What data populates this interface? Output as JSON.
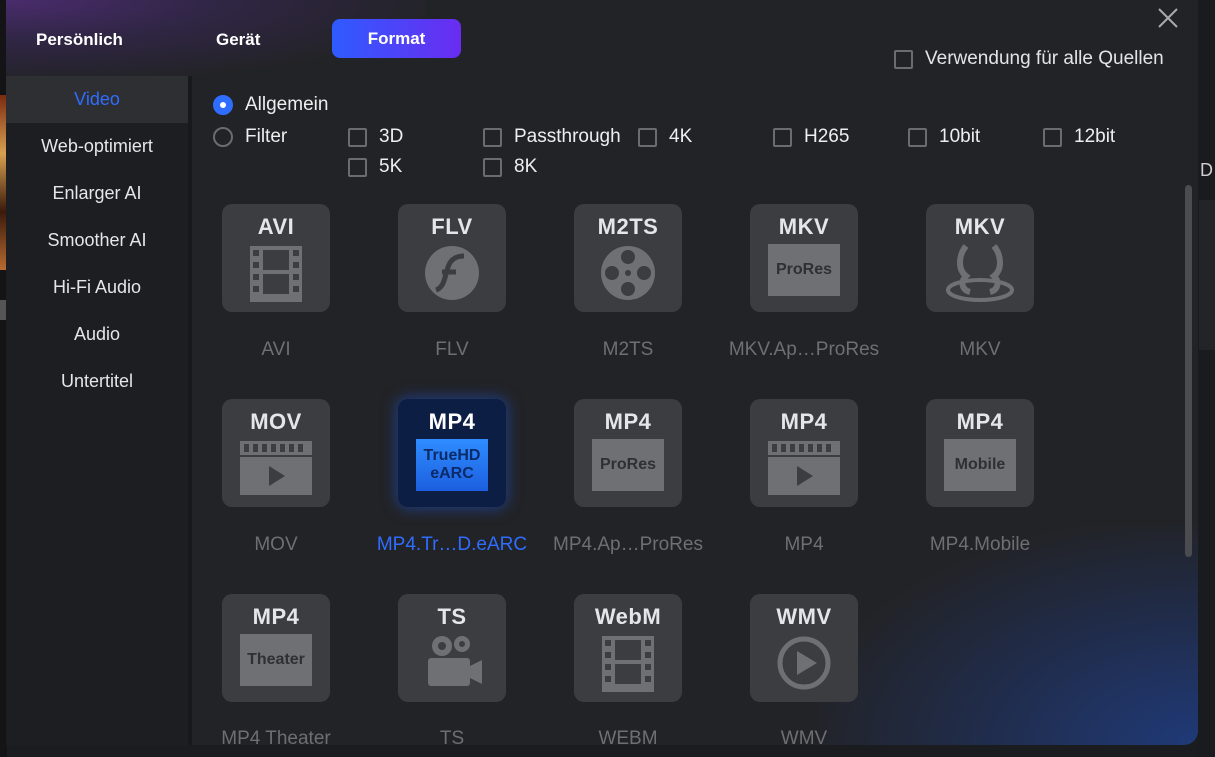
{
  "dialog": {
    "tabs": [
      {
        "label": "Persönlich"
      },
      {
        "label": "Gerät"
      },
      {
        "label": "Format",
        "active": true
      }
    ],
    "all_sources_label": "Verwendung für alle Quellen",
    "all_sources_checked": false,
    "background_right_letter": "D"
  },
  "sidebar": {
    "items": [
      {
        "label": "Video",
        "active": true
      },
      {
        "label": "Web-optimiert"
      },
      {
        "label": "Enlarger AI"
      },
      {
        "label": "Smoother AI"
      },
      {
        "label": "Hi-Fi Audio"
      },
      {
        "label": "Audio"
      },
      {
        "label": "Untertitel"
      }
    ]
  },
  "filters": {
    "radio_general": {
      "label": "Allgemein",
      "selected": true
    },
    "radio_filter": {
      "label": "Filter",
      "selected": false
    },
    "checks": [
      {
        "label": "3D",
        "checked": false
      },
      {
        "label": "Passthrough",
        "checked": false
      },
      {
        "label": "4K",
        "checked": false
      },
      {
        "label": "H265",
        "checked": false
      },
      {
        "label": "10bit",
        "checked": false
      },
      {
        "label": "12bit",
        "checked": false
      },
      {
        "label": "5K",
        "checked": false
      },
      {
        "label": "8K",
        "checked": false
      }
    ]
  },
  "formats": [
    {
      "title": "AVI",
      "label": "AVI",
      "icon": "film-strip-icon"
    },
    {
      "title": "FLV",
      "label": "FLV",
      "icon": "flash-icon"
    },
    {
      "title": "M2TS",
      "label": "M2TS",
      "icon": "film-reel-icon"
    },
    {
      "title": "MKV",
      "box": "ProRes",
      "label": "MKV.Ap…ProRes",
      "icon": "prores-box-icon"
    },
    {
      "title": "MKV",
      "label": "MKV",
      "icon": "matroska-icon"
    },
    {
      "title": "MOV",
      "label": "MOV",
      "icon": "clapper-play-icon"
    },
    {
      "title": "MP4",
      "box": "TrueHD eARC",
      "label": "MP4.Tr…D.eARC",
      "icon": "truehd-box-icon",
      "selected": true
    },
    {
      "title": "MP4",
      "box": "ProRes",
      "label": "MP4.Ap…ProRes",
      "icon": "prores-box-icon"
    },
    {
      "title": "MP4",
      "label": "MP4",
      "icon": "clapper-play-icon"
    },
    {
      "title": "MP4",
      "box": "Mobile",
      "label": "MP4.Mobile",
      "icon": "mobile-box-icon"
    },
    {
      "title": "MP4",
      "box": "Theater",
      "label": "MP4 Theater",
      "icon": "theater-box-icon"
    },
    {
      "title": "TS",
      "label": "TS",
      "icon": "video-camera-icon"
    },
    {
      "title": "WebM",
      "label": "WEBM",
      "icon": "film-strip-icon"
    },
    {
      "title": "WMV",
      "label": "WMV",
      "icon": "play-circle-icon"
    }
  ],
  "colors": {
    "accent": "#2f6dff",
    "format_tab_gradient": [
      "#2f5bff",
      "#6a2cf0"
    ],
    "tile": "#3c3d41",
    "tile_selected": "#0d1e44"
  }
}
